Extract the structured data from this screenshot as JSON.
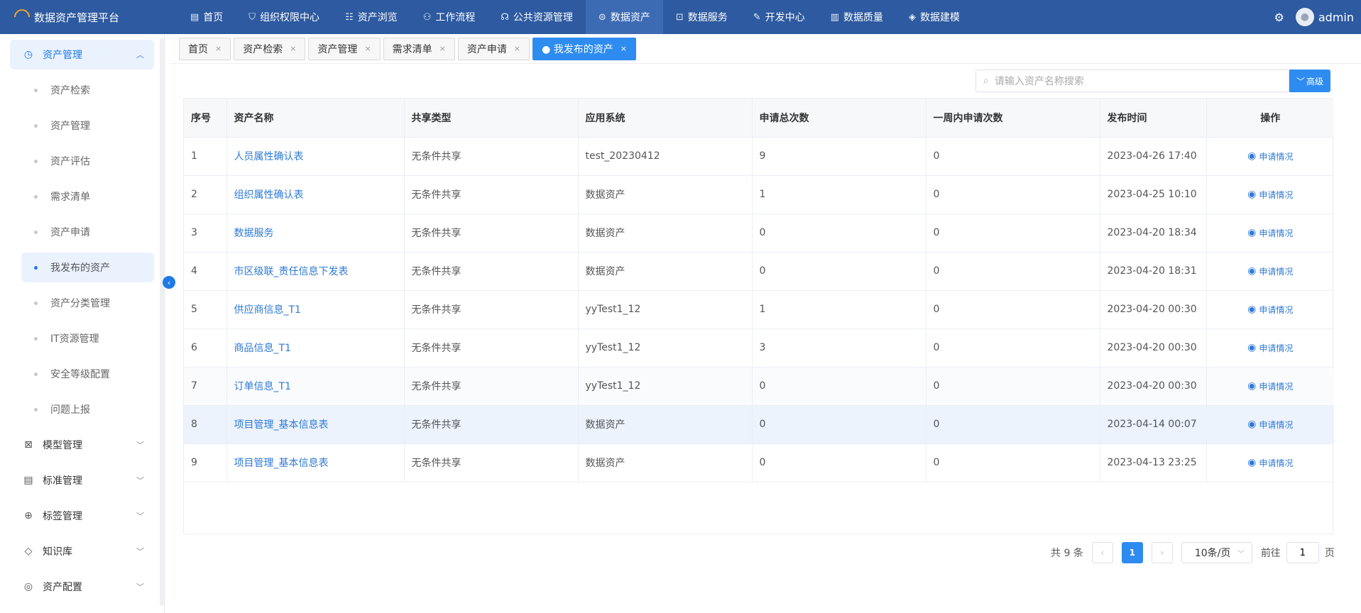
{
  "app": {
    "title": "数据资产管理平台",
    "user": "admin"
  },
  "nav": [
    {
      "label": "首页",
      "icon": "document-icon",
      "glyph": "▤",
      "active": false
    },
    {
      "label": "组织权限中心",
      "icon": "shield-icon",
      "glyph": "⛉",
      "active": false
    },
    {
      "label": "资产浏览",
      "icon": "list-icon",
      "glyph": "☷",
      "active": false
    },
    {
      "label": "工作流程",
      "icon": "workflow-icon",
      "glyph": "⚇",
      "active": false
    },
    {
      "label": "公共资源管理",
      "icon": "gamepad-icon",
      "glyph": "☊",
      "active": false
    },
    {
      "label": "数据资产",
      "icon": "database-icon",
      "glyph": "⊜",
      "active": true
    },
    {
      "label": "数据服务",
      "icon": "chart-icon",
      "glyph": "⊡",
      "active": false
    },
    {
      "label": "开发中心",
      "icon": "edit-icon",
      "glyph": "✎",
      "active": false
    },
    {
      "label": "数据质量",
      "icon": "bar-chart-icon",
      "glyph": "▥",
      "active": false
    },
    {
      "label": "数据建模",
      "icon": "layers-icon",
      "glyph": "◈",
      "active": false
    }
  ],
  "sidebar": {
    "group_open": {
      "label": "资产管理",
      "icon": "clock-icon",
      "glyph": "◷"
    },
    "items": [
      {
        "label": "资产检索",
        "active": false
      },
      {
        "label": "资产管理",
        "active": false
      },
      {
        "label": "资产评估",
        "active": false
      },
      {
        "label": "需求清单",
        "active": false
      },
      {
        "label": "资产申请",
        "active": false
      },
      {
        "label": "我发布的资产",
        "active": true
      },
      {
        "label": "资产分类管理",
        "active": false
      },
      {
        "label": "IT资源管理",
        "active": false
      },
      {
        "label": "安全等级配置",
        "active": false
      },
      {
        "label": "问题上报",
        "active": false
      }
    ],
    "groups": [
      {
        "label": "模型管理",
        "icon": "model-icon",
        "glyph": "⊠"
      },
      {
        "label": "标准管理",
        "icon": "file-icon",
        "glyph": "▤"
      },
      {
        "label": "标签管理",
        "icon": "plus-circle-icon",
        "glyph": "⊕"
      },
      {
        "label": "知识库",
        "icon": "tag-icon",
        "glyph": "◇"
      },
      {
        "label": "资产配置",
        "icon": "settings-icon",
        "glyph": "◎"
      }
    ]
  },
  "tabs": [
    {
      "label": "首页",
      "active": false
    },
    {
      "label": "资产检索",
      "active": false
    },
    {
      "label": "资产管理",
      "active": false
    },
    {
      "label": "需求清单",
      "active": false
    },
    {
      "label": "资产申请",
      "active": false
    },
    {
      "label": "● 我发布的资产",
      "active": true
    }
  ],
  "search": {
    "placeholder": "请输入资产名称搜索",
    "advanced_label": "高级"
  },
  "table": {
    "columns": [
      "序号",
      "资产名称",
      "共享类型",
      "应用系统",
      "申请总次数",
      "一周内申请次数",
      "发布时间",
      "操作"
    ],
    "rows": [
      {
        "no": "1",
        "name": "人员属性确认表",
        "share": "无条件共享",
        "system": "test_20230412",
        "total": "9",
        "week": "0",
        "time": "2023-04-26 17:40",
        "op": "申请情况"
      },
      {
        "no": "2",
        "name": "组织属性确认表",
        "share": "无条件共享",
        "system": "数据资产",
        "total": "1",
        "week": "0",
        "time": "2023-04-25 10:10",
        "op": "申请情况"
      },
      {
        "no": "3",
        "name": "数据服务",
        "share": "无条件共享",
        "system": "数据资产",
        "total": "0",
        "week": "0",
        "time": "2023-04-20 18:34",
        "op": "申请情况"
      },
      {
        "no": "4",
        "name": "市区级联_责任信息下发表",
        "share": "无条件共享",
        "system": "数据资产",
        "total": "0",
        "week": "0",
        "time": "2023-04-20 18:31",
        "op": "申请情况"
      },
      {
        "no": "5",
        "name": "供应商信息_T1",
        "share": "无条件共享",
        "system": "yyTest1_12",
        "total": "1",
        "week": "0",
        "time": "2023-04-20 00:30",
        "op": "申请情况"
      },
      {
        "no": "6",
        "name": "商品信息_T1",
        "share": "无条件共享",
        "system": "yyTest1_12",
        "total": "3",
        "week": "0",
        "time": "2023-04-20 00:30",
        "op": "申请情况"
      },
      {
        "no": "7",
        "name": "订单信息_T1",
        "share": "无条件共享",
        "system": "yyTest1_12",
        "total": "0",
        "week": "0",
        "time": "2023-04-20 00:30",
        "op": "申请情况"
      },
      {
        "no": "8",
        "name": "项目管理_基本信息表",
        "share": "无条件共享",
        "system": "数据资产",
        "total": "0",
        "week": "0",
        "time": "2023-04-14 00:07",
        "op": "申请情况"
      },
      {
        "no": "9",
        "name": "项目管理_基本信息表",
        "share": "无条件共享",
        "system": "数据资产",
        "total": "0",
        "week": "0",
        "time": "2023-04-13 23:25",
        "op": "申请情况"
      }
    ]
  },
  "pagination": {
    "total_text": "共 9 条",
    "current": "1",
    "page_size": "10条/页",
    "goto_label": "前往",
    "goto_value": "1",
    "page_suffix": "页"
  },
  "colors": {
    "nav_bg": "#2d5aa0",
    "accent": "#2e8cf0",
    "link": "#2e7ad6"
  }
}
